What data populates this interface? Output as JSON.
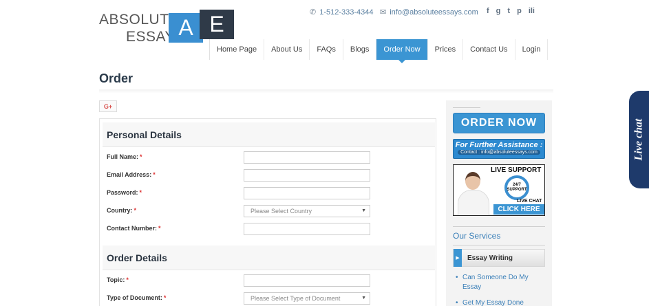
{
  "logo": {
    "line1": "ABSOLUTE",
    "line2": "ESSAY",
    "letter_a": "A",
    "letter_e": "E"
  },
  "header": {
    "phone": "1-512-333-4344",
    "email": "info@absoluteessays.com",
    "social": [
      "f",
      "g",
      "t",
      "p",
      "ili"
    ]
  },
  "nav": {
    "items": [
      "Home Page",
      "About Us",
      "FAQs",
      "Blogs",
      "Order Now",
      "Prices",
      "Contact Us",
      "Login"
    ],
    "active": "Order Now"
  },
  "page": {
    "title": "Order",
    "share_label": "G+"
  },
  "form": {
    "personal_heading": "Personal Details",
    "order_heading": "Order Details",
    "required_mark": "*",
    "fields": {
      "full_name": "Full Name:",
      "email": "Email Address:",
      "password": "Password:",
      "country": "Country:",
      "contact": "Contact Number:",
      "topic": "Topic:",
      "doc_type": "Type of Document:"
    },
    "country_placeholder": "Please Select Country",
    "doc_type_placeholder": "Please Select Type of Document"
  },
  "sidebar": {
    "order_now": "ORDER NOW",
    "assist_title": "For Further Assistance :",
    "assist_contact": "Contact : info@absoluteessays.com",
    "support_title": "LIVE SUPPORT",
    "support_247": "24/7",
    "support_small": "SUPPORT",
    "support_live": "LIVE CHAT",
    "support_click": "CLICK HERE",
    "services_heading": "Our Services",
    "services_tab": "Essay Writing",
    "services": [
      "Can Someone Do My Essay",
      "Get My Essay Done"
    ]
  },
  "live_chat": {
    "label": "Live chat"
  },
  "colors": {
    "accent": "#3b95d3",
    "dark": "#2f3a48",
    "livechat": "#1e3a6b"
  }
}
